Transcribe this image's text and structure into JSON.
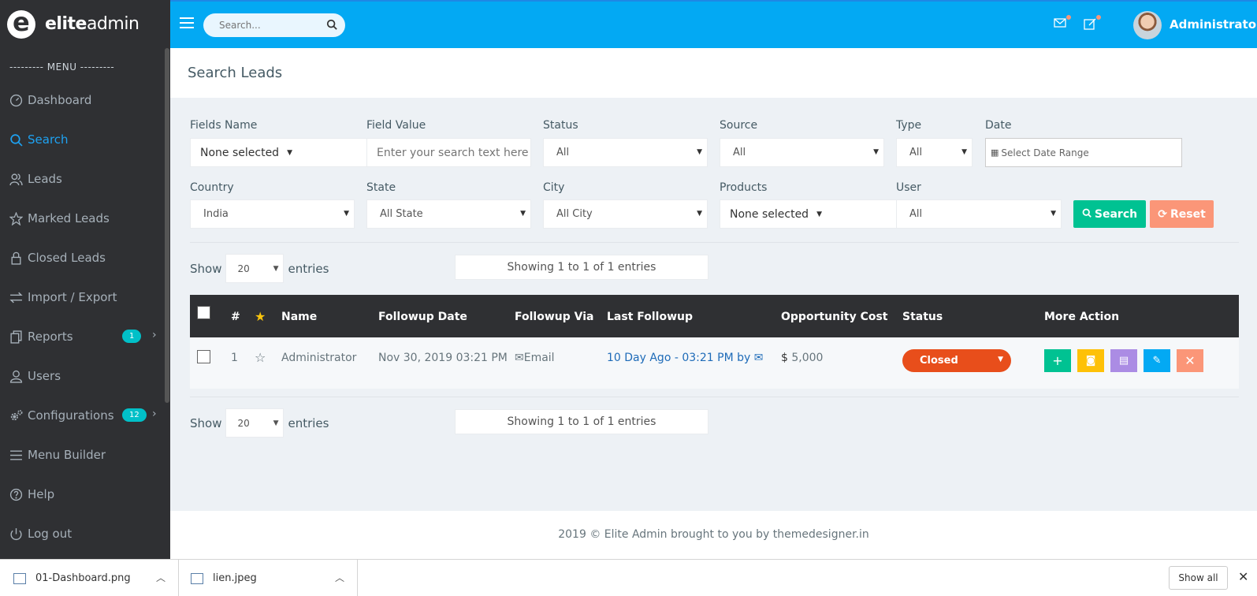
{
  "brand": {
    "bold": "elite",
    "light": "admin"
  },
  "sidebar": {
    "caption": "--------- MENU ---------",
    "items": [
      {
        "label": "Dashboard",
        "icon": "gauge-icon"
      },
      {
        "label": "Search",
        "icon": "search-icon",
        "active": true
      },
      {
        "label": "Leads",
        "icon": "users-icon"
      },
      {
        "label": "Marked Leads",
        "icon": "star-icon"
      },
      {
        "label": "Closed Leads",
        "icon": "lock-icon"
      },
      {
        "label": "Import / Export",
        "icon": "exchange-icon"
      },
      {
        "label": "Reports",
        "icon": "copy-icon",
        "badge": "1"
      },
      {
        "label": "Users",
        "icon": "user-icon"
      },
      {
        "label": "Configurations",
        "icon": "gears-icon",
        "badge": "12"
      },
      {
        "label": "Menu Builder",
        "icon": "bars-icon"
      },
      {
        "label": "Help",
        "icon": "question-icon"
      },
      {
        "label": "Log out",
        "icon": "logout-icon"
      }
    ]
  },
  "topbar": {
    "search_placeholder": "Search...",
    "user": "Administrator"
  },
  "page_title": "Search Leads",
  "filters": {
    "fields_name": {
      "label": "Fields Name",
      "value": "None selected"
    },
    "field_value": {
      "label": "Field Value",
      "placeholder": "Enter your search text here"
    },
    "status": {
      "label": "Status",
      "value": "All"
    },
    "source": {
      "label": "Source",
      "value": "All"
    },
    "type": {
      "label": "Type",
      "value": "All"
    },
    "date": {
      "label": "Date",
      "placeholder": "Select Date Range"
    },
    "country": {
      "label": "Country",
      "value": "India"
    },
    "state": {
      "label": "State",
      "value": "All State"
    },
    "city": {
      "label": "City",
      "value": "All City"
    },
    "products": {
      "label": "Products",
      "value": "None selected"
    },
    "user": {
      "label": "User",
      "value": "All"
    },
    "search_btn": "Search",
    "reset_btn": "Reset"
  },
  "table_ctrl": {
    "show": "Show",
    "entries_value": "20",
    "entries": "entries",
    "info": "Showing 1 to 1 of 1 entries"
  },
  "table": {
    "headers": [
      "#",
      "Name",
      "Followup Date",
      "Followup Via",
      "Last Followup",
      "Opportunity Cost",
      "Status",
      "More Action"
    ],
    "rows": [
      {
        "num": "1",
        "name": "Administrator",
        "followup_date": "Nov 30, 2019 03:21 PM",
        "followup_via": "Email",
        "last_followup": "10 Day Ago - 03:21 PM by",
        "currency": "$",
        "cost": "5,000",
        "status": "Closed"
      }
    ]
  },
  "footer": "2019 © Elite Admin brought to you by themedesigner.in",
  "downloads": {
    "items": [
      "01-Dashboard.png",
      "lien.jpeg"
    ],
    "show_all": "Show all"
  },
  "colors": {
    "topbar": "#03a9f3",
    "sidebar": "#2f3033",
    "success": "#00c292",
    "warning": "#fb9678",
    "status_closed": "#e84e1b"
  }
}
